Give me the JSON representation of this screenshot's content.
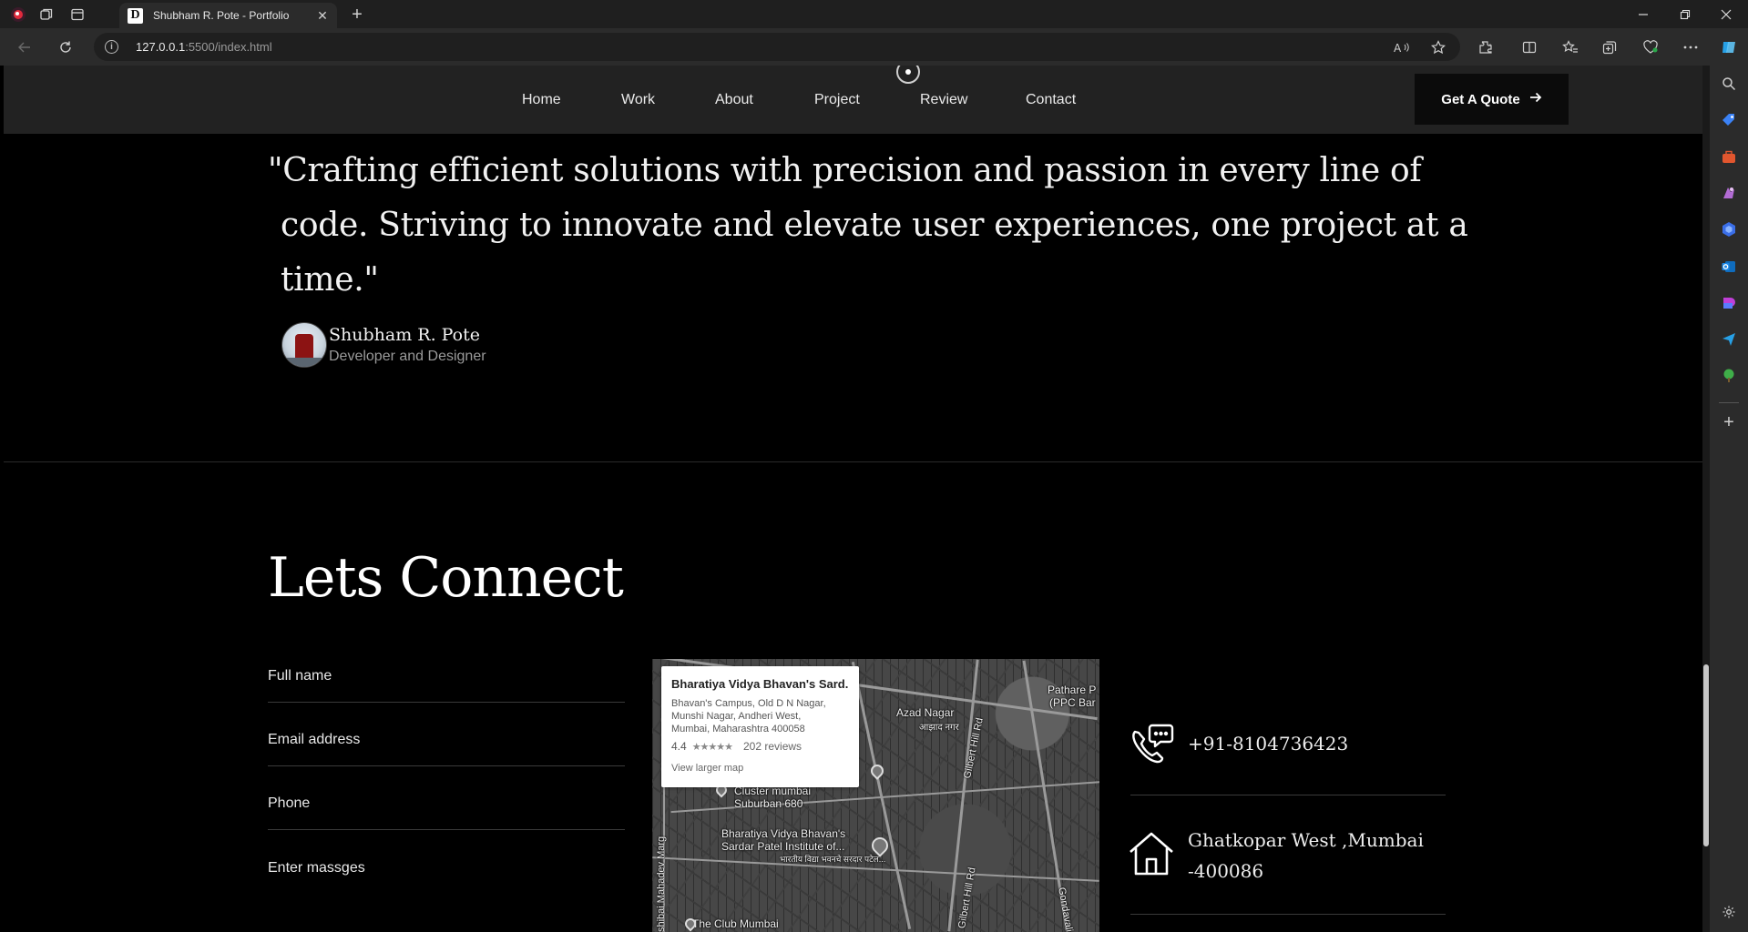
{
  "browser": {
    "tab_title": "Shubham R. Pote - Portfolio",
    "tab_favicon_letter": "D",
    "url_host": "127.0.0.1",
    "url_rest": ":5500/index.html"
  },
  "nav": {
    "links": [
      "Home",
      "Work",
      "About",
      "Project",
      "Review",
      "Contact"
    ],
    "cta_label": "Get A Quote"
  },
  "testimonial": {
    "lines": [
      "\"Crafting efficient solutions with precision and passion in every line of",
      "code. Striving to innovate and elevate user experiences, one project at a",
      "time.\""
    ],
    "author_name": "Shubham R. Pote",
    "author_role": "Developer and Designer"
  },
  "connect": {
    "title": "Lets Connect",
    "fields": {
      "full_name": "Full name",
      "email": "Email address",
      "phone": "Phone",
      "message": "Enter massges"
    },
    "map": {
      "place_title": "Bharatiya Vidya Bhavan's Sard...",
      "address_line1": "Bhavan's Campus, Old D N Nagar,",
      "address_line2": "Munshi Nagar, Andheri West,",
      "address_line3": "Mumbai, Maharashtra 400058",
      "rating": "4.4",
      "stars": "★★★★★",
      "reviews": "202 reviews",
      "larger_map": "View larger map",
      "labels": {
        "azad_nagar": "Azad Nagar",
        "azad_nagar_hi": "आझाद नगर",
        "pathare": "Pathare P",
        "ppc_bar": "(PPC Bar",
        "gilbert_hill": "Gilbert Hill Rd",
        "gilbert_hill_2": "Gilbert Hill Rd",
        "cluster": "Cluster mumbai",
        "suburban": "Suburban 680",
        "bvb1": "Bharatiya Vidya Bhavan's",
        "bvb2": "Sardar Patel Institute of...",
        "bvb_hi": "भारतीय विद्या भवनचे सरदार पटेल...",
        "mahadev": "shibai Mahadev Marg",
        "club": "The Club Mumbai",
        "gondavali": "Gondavali Rd"
      }
    },
    "phone": "+91-8104736423",
    "address_line1": "Ghatkopar West ,Mumbai",
    "address_line2": "-400086"
  }
}
